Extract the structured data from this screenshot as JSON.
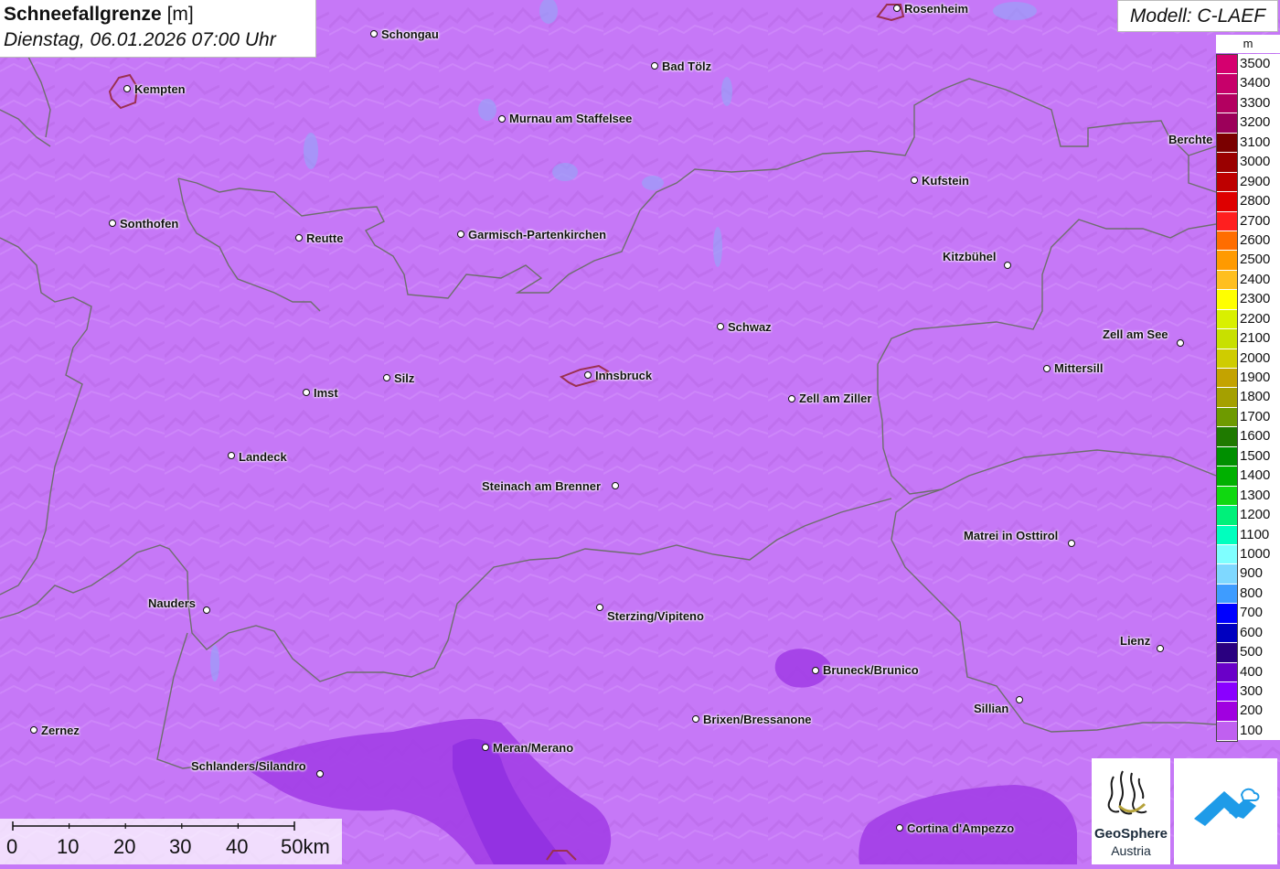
{
  "header": {
    "title": "Schneefallgrenze",
    "unit": "[m]",
    "datetime": "Dienstag, 06.01.2026 07:00 Uhr"
  },
  "model_label": "Modell: C-LAEF",
  "legend": {
    "unit": "m",
    "entries": [
      {
        "label": "3500",
        "color": "#d5006f"
      },
      {
        "label": "3400",
        "color": "#c7006a"
      },
      {
        "label": "3300",
        "color": "#b30060"
      },
      {
        "label": "3200",
        "color": "#9c005a"
      },
      {
        "label": "3100",
        "color": "#7a0000"
      },
      {
        "label": "3000",
        "color": "#9a0000"
      },
      {
        "label": "2900",
        "color": "#be0000"
      },
      {
        "label": "2800",
        "color": "#de0000"
      },
      {
        "label": "2700",
        "color": "#ff1f1f"
      },
      {
        "label": "2600",
        "color": "#ff6d00"
      },
      {
        "label": "2500",
        "color": "#ff9a00"
      },
      {
        "label": "2400",
        "color": "#ffbf1f"
      },
      {
        "label": "2300",
        "color": "#ffff00"
      },
      {
        "label": "2200",
        "color": "#d9f000"
      },
      {
        "label": "2100",
        "color": "#c8e000"
      },
      {
        "label": "2000",
        "color": "#cfcc00"
      },
      {
        "label": "1900",
        "color": "#c4a300"
      },
      {
        "label": "1800",
        "color": "#a5a000"
      },
      {
        "label": "1700",
        "color": "#6e9a00"
      },
      {
        "label": "1600",
        "color": "#1f7a00"
      },
      {
        "label": "1500",
        "color": "#008f00"
      },
      {
        "label": "1400",
        "color": "#00b000"
      },
      {
        "label": "1300",
        "color": "#10d810"
      },
      {
        "label": "1200",
        "color": "#00f07a"
      },
      {
        "label": "1100",
        "color": "#00ffbe"
      },
      {
        "label": "1000",
        "color": "#7fffff"
      },
      {
        "label": "900",
        "color": "#7fd8ff"
      },
      {
        "label": "800",
        "color": "#3e9cff"
      },
      {
        "label": "700",
        "color": "#0000ff"
      },
      {
        "label": "600",
        "color": "#0000c0"
      },
      {
        "label": "500",
        "color": "#2a0080"
      },
      {
        "label": "400",
        "color": "#6a00c8"
      },
      {
        "label": "300",
        "color": "#8a00ff"
      },
      {
        "label": "200",
        "color": "#a000e0"
      },
      {
        "label": "100",
        "color": "#c060f0"
      }
    ]
  },
  "cities": [
    {
      "id": "rosenheim",
      "name": "Rosenheim"
    },
    {
      "id": "schongau",
      "name": "Schongau"
    },
    {
      "id": "kempten",
      "name": "Kempten"
    },
    {
      "id": "bad-toelz",
      "name": "Bad Tölz"
    },
    {
      "id": "murnau",
      "name": "Murnau am Staffelsee"
    },
    {
      "id": "berchtesgaden",
      "name": "Berchte"
    },
    {
      "id": "kufstein",
      "name": "Kufstein"
    },
    {
      "id": "sonthofen",
      "name": "Sonthofen"
    },
    {
      "id": "reutte",
      "name": "Reutte"
    },
    {
      "id": "garmisch",
      "name": "Garmisch-Partenkirchen"
    },
    {
      "id": "kitzbuehel",
      "name": "Kitzbühel"
    },
    {
      "id": "schwaz",
      "name": "Schwaz"
    },
    {
      "id": "zell-am-see",
      "name": "Zell am See"
    },
    {
      "id": "mittersill",
      "name": "Mittersill"
    },
    {
      "id": "innsbruck",
      "name": "Innsbruck"
    },
    {
      "id": "imst",
      "name": "Imst"
    },
    {
      "id": "silz",
      "name": "Silz"
    },
    {
      "id": "zell-am-ziller",
      "name": "Zell am Ziller"
    },
    {
      "id": "landeck",
      "name": "Landeck"
    },
    {
      "id": "steinach",
      "name": "Steinach am Brenner"
    },
    {
      "id": "matrei",
      "name": "Matrei in Osttirol"
    },
    {
      "id": "nauders",
      "name": "Nauders"
    },
    {
      "id": "sterzing",
      "name": "Sterzing/Vipiteno"
    },
    {
      "id": "lienz",
      "name": "Lienz"
    },
    {
      "id": "bruneck",
      "name": "Bruneck/Brunico"
    },
    {
      "id": "sillian",
      "name": "Sillian"
    },
    {
      "id": "zernez",
      "name": "Zernez"
    },
    {
      "id": "brixen",
      "name": "Brixen/Bressanone"
    },
    {
      "id": "meran",
      "name": "Meran/Merano"
    },
    {
      "id": "schlanders",
      "name": "Schlanders/Silandro"
    },
    {
      "id": "cortina",
      "name": "Cortina d'Ampezzo"
    }
  ],
  "scale_bar": {
    "labels": [
      "0",
      "10",
      "20",
      "30",
      "40",
      "50km"
    ]
  },
  "logos": {
    "geosphere_line1": "GeoSphere",
    "geosphere_line2": "Austria"
  },
  "colors": {
    "background_fill": "#c678f7",
    "low_fill": "#a23ee6",
    "lowest_fill": "#8f2fe0",
    "border": "#6e6e6e"
  }
}
